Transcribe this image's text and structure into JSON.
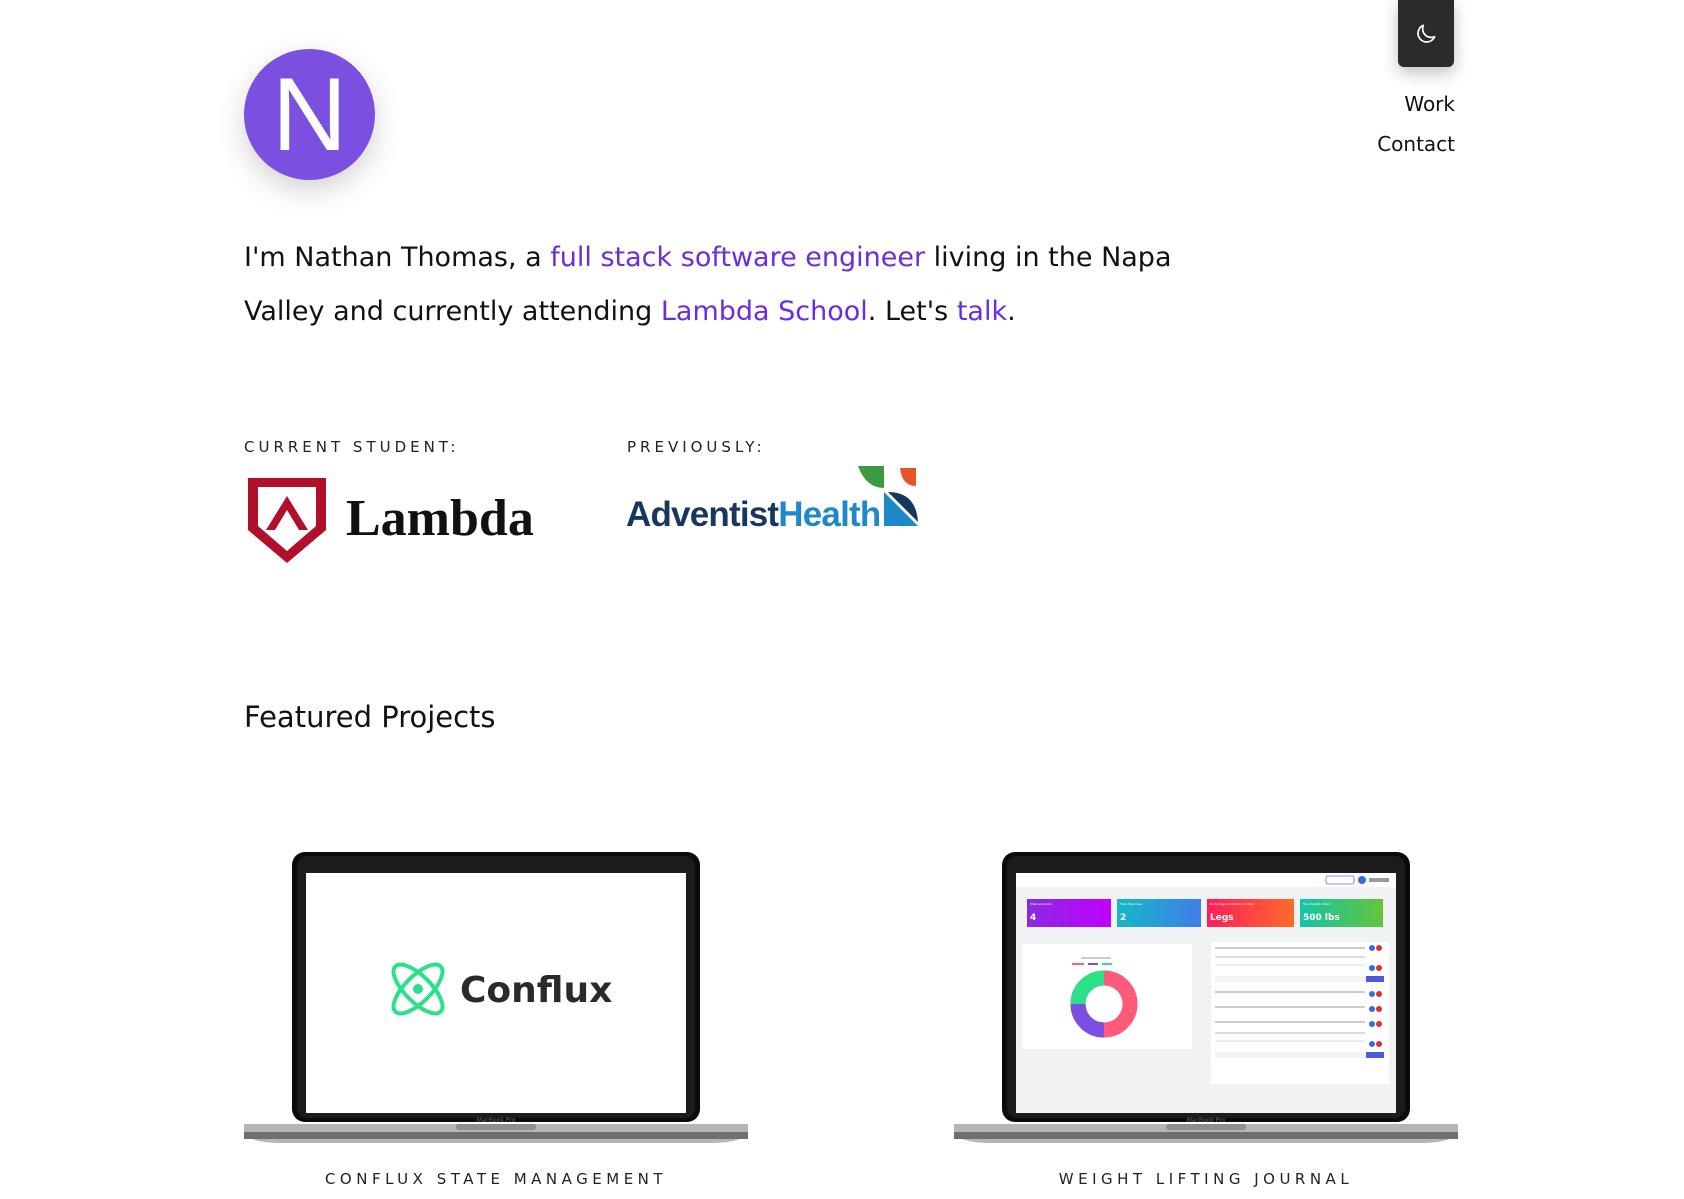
{
  "header": {
    "avatar_letter": "N",
    "theme_toggle_icon": "moon-icon",
    "nav": [
      {
        "label": "Work"
      },
      {
        "label": "Contact"
      }
    ]
  },
  "intro": {
    "t1": "I'm Nathan Thomas, a ",
    "link1": "full stack software engineer",
    "t2": " living in the Napa Valley and currently attending ",
    "link2": "Lambda School",
    "t3": ". Let's ",
    "link3": "talk",
    "t4": "."
  },
  "education": {
    "current_caption": "CURRENT STUDENT:",
    "current_logo_text": "Lambda",
    "previous_caption": "PREVIOUSLY:",
    "previous_logo_text_1": "Adventist",
    "previous_logo_text_2": "Health"
  },
  "featured": {
    "title": "Featured Projects",
    "projects": [
      {
        "caption": "CONFLUX STATE MANAGEMENT",
        "screen_logo_text": "Conflux",
        "laptop_label": "MacBook Pro"
      },
      {
        "caption": "WEIGHT LIFTING JOURNAL",
        "laptop_label": "MacBook Pro",
        "stats": [
          {
            "label": "Total workouts",
            "value": "4"
          },
          {
            "label": "Total Exercises",
            "value": "2"
          },
          {
            "label": "Body Region Worked on Most",
            "value": "Legs"
          },
          {
            "label": "Max Weight Lifted",
            "value": "500 lbs"
          }
        ]
      }
    ]
  },
  "colors": {
    "accent": "#6a2de0",
    "avatar": "#7b4fe0",
    "toggle_bg": "#2b2b2b",
    "lambda_red": "#b0102a",
    "adventist_navy": "#17375e",
    "adventist_blue": "#1e88c9",
    "conflux_green": "#2de08a"
  }
}
